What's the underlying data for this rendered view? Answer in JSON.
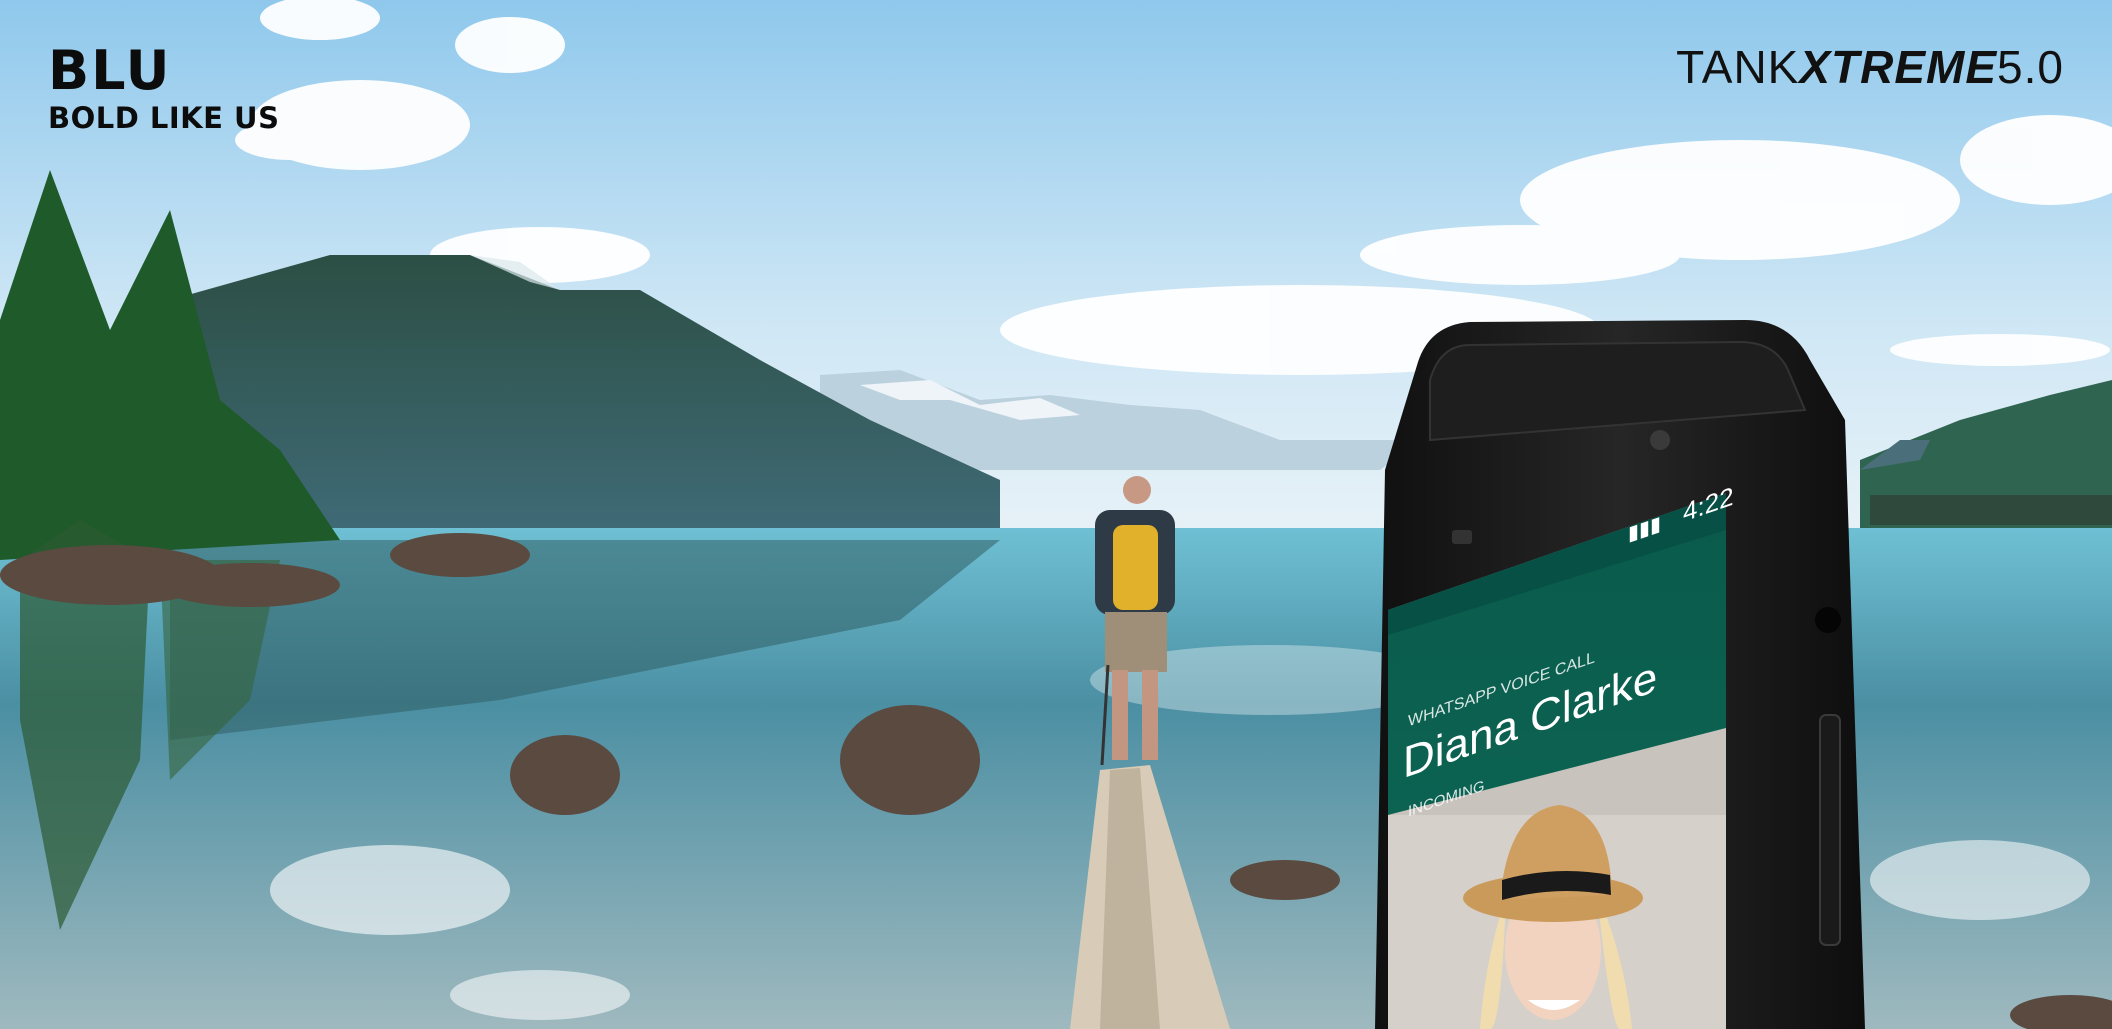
{
  "brand": {
    "logo": "BLU",
    "tagline": "BOLD LIKE US"
  },
  "product": {
    "name_light": "TANK",
    "name_bold": "XTREME",
    "version": "5.0"
  },
  "phone": {
    "status_time": "4:22",
    "call_type": "WHATSAPP VOICE CALL",
    "caller_name": "Diana Clarke",
    "call_state": "INCOMING"
  },
  "colors": {
    "sky_top": "#9fd0ef",
    "lake": "#5aa9c4",
    "whatsapp_green": "#0b5b4b",
    "phone_body": "#1b1b1b"
  }
}
